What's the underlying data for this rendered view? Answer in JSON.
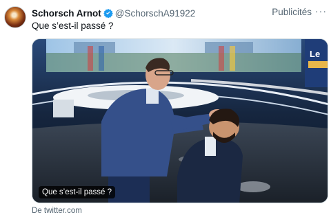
{
  "tweet": {
    "author_name": "Schorsch Arnot",
    "handle": "@SchorschA91922",
    "ad_label": "Publicités",
    "more_label": "···",
    "text": "Que s’est-il passé ?"
  },
  "media": {
    "caption": "Que s’est-il passé ?",
    "corner_text": "Le"
  },
  "card": {
    "source": "De twitter.com"
  },
  "colors": {
    "verified_blue": "#1d9bf0",
    "secondary_text": "#536471"
  },
  "icons": {
    "verified": "verified-badge-icon",
    "more": "more-options-icon"
  }
}
